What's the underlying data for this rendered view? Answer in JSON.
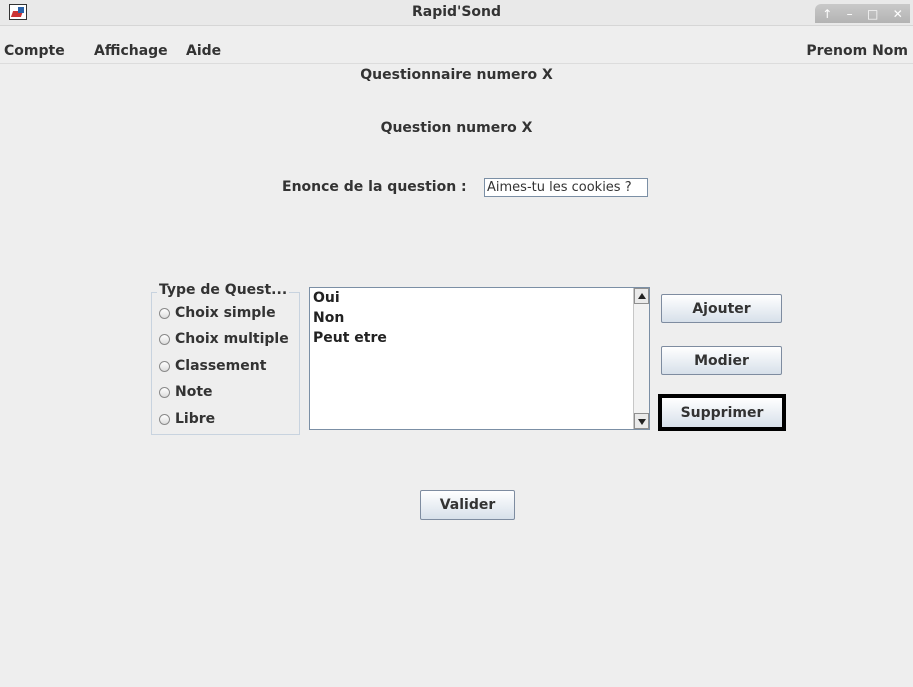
{
  "window": {
    "title": "Rapid'Sond",
    "controls": [
      "↑",
      "–",
      "□",
      "✕"
    ]
  },
  "menubar": {
    "items": [
      "Compte",
      "Affichage",
      "Aide"
    ],
    "user": "Prenom Nom"
  },
  "main": {
    "questionnaire_title": "Questionnaire numero X",
    "question_title": "Question numero X",
    "enonce_label": "Enonce de la question :",
    "enonce_value": "Aimes-tu les cookies ?",
    "type_group": {
      "title": "Type de Quest...",
      "options": [
        "Choix simple",
        "Choix multiple",
        "Classement",
        "Note",
        "Libre"
      ]
    },
    "answers": [
      "Oui",
      "Non",
      "Peut etre"
    ],
    "buttons": {
      "add": "Ajouter",
      "modify": "Modier",
      "delete": "Supprimer",
      "validate": "Valider"
    }
  }
}
